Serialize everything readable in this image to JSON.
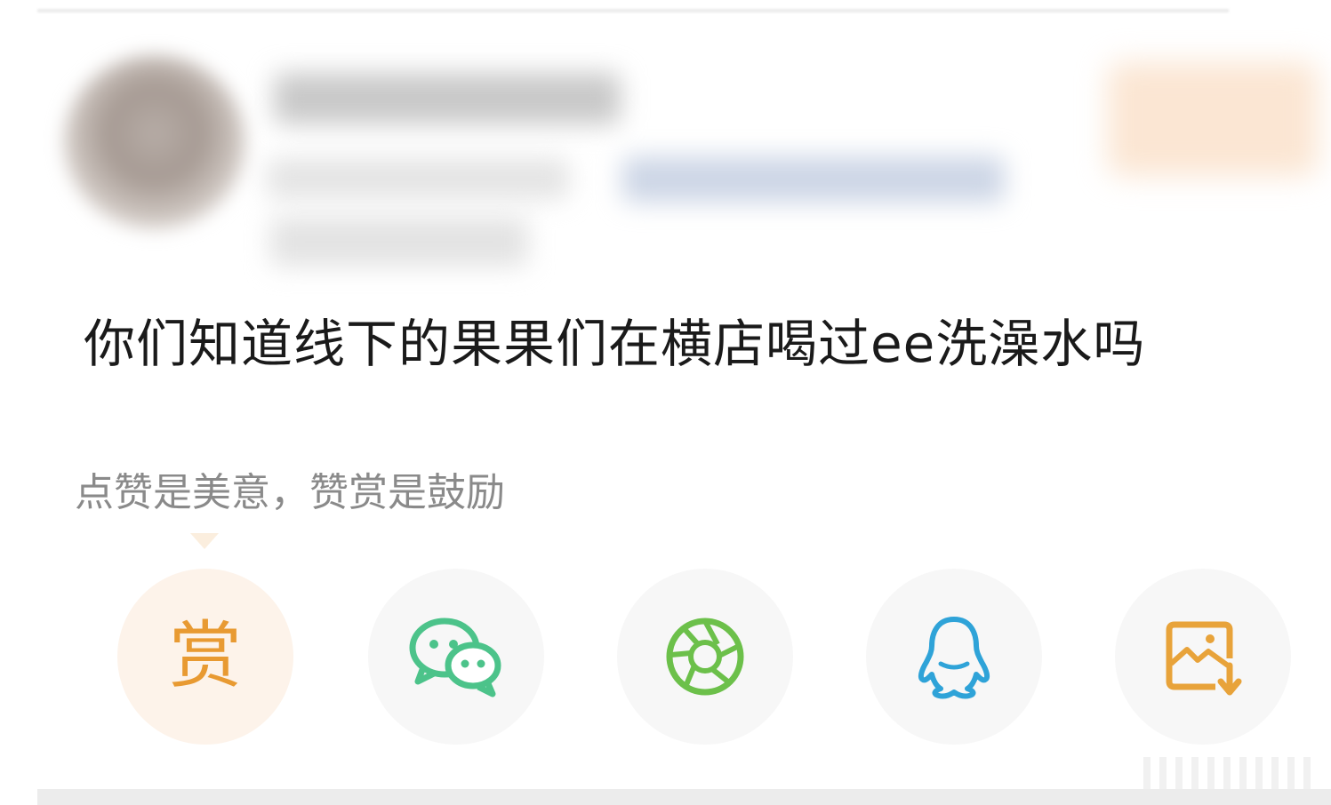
{
  "post": {
    "text": "你们知道线下的果果们在横店喝过ee洗澡水吗"
  },
  "reward": {
    "hint": "点赞是美意，赞赏是鼓励",
    "button_label": "赏"
  },
  "share_actions": [
    {
      "icon": "reward-icon",
      "color": "#E89A32"
    },
    {
      "icon": "wechat-icon",
      "color": "#4CC38A"
    },
    {
      "icon": "moments-icon",
      "color": "#6CC04A"
    },
    {
      "icon": "qq-icon",
      "color": "#2FA3D8"
    },
    {
      "icon": "save-image-icon",
      "color": "#E8A33A"
    }
  ]
}
